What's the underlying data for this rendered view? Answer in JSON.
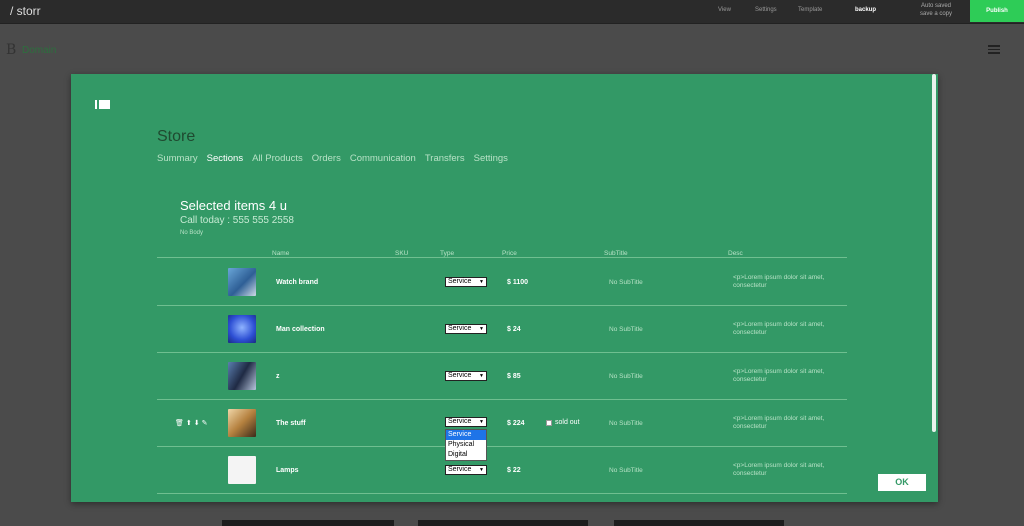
{
  "topbar": {
    "brand": "/ storr",
    "nav": [
      "View",
      "Settings",
      "Template",
      "backup"
    ],
    "status_line1": "Auto saved",
    "status_line2": "save a copy",
    "publish_label": "Publish",
    "publish_color": "#2ecc57"
  },
  "background": {
    "logo": "B",
    "domain": "Domain",
    "menu_icon": "hamburger-icon"
  },
  "modal": {
    "bg_color": "#339966",
    "panel_icon": "panel-toggle-icon",
    "store_title": "Store",
    "tabs": [
      "Summary",
      "Sections",
      "All Products",
      "Orders",
      "Communication",
      "Transfers",
      "Settings"
    ],
    "active_tab": "Sections",
    "section": {
      "title": "Selected items 4 u",
      "subtitle": "Call today : 555 555 2558",
      "body": "No Body"
    },
    "columns": [
      "Name",
      "SKU",
      "Type",
      "Price",
      "SubTitle",
      "Desc"
    ],
    "rows": [
      {
        "name": "Watch brand",
        "type": "Service",
        "price": "$ 1100",
        "subtitle": "No SubTitle",
        "desc": "<p>Lorem ipsum dolor sit amet, consectetur"
      },
      {
        "name": "Man collection",
        "type": "Service",
        "price": "$ 24",
        "subtitle": "No SubTitle",
        "desc": "<p>Lorem ipsum dolor sit amet, consectetur"
      },
      {
        "name": "z",
        "type": "Service",
        "price": "$ 85",
        "subtitle": "No SubTitle",
        "desc": "<p>Lorem ipsum dolor sit amet, consectetur"
      },
      {
        "name": "The stuff",
        "type": "Service",
        "price": "$ 224",
        "subtitle": "No SubTitle",
        "desc": "<p>Lorem ipsum dolor sit amet, consectetur",
        "sold_out_label": "sold out"
      },
      {
        "name": "Lamps",
        "type": "Service",
        "price": "$ 22",
        "subtitle": "No SubTitle",
        "desc": "<p>Lorem ipsum dolor sit amet, consectetur"
      }
    ],
    "row_tools": [
      "trash-icon",
      "arrow-up-icon",
      "arrow-down-icon",
      "edit-icon"
    ],
    "dropdown_options": [
      "Service",
      "Physical",
      "Digital"
    ],
    "dropdown_selected": "Service",
    "ok_label": "OK"
  }
}
